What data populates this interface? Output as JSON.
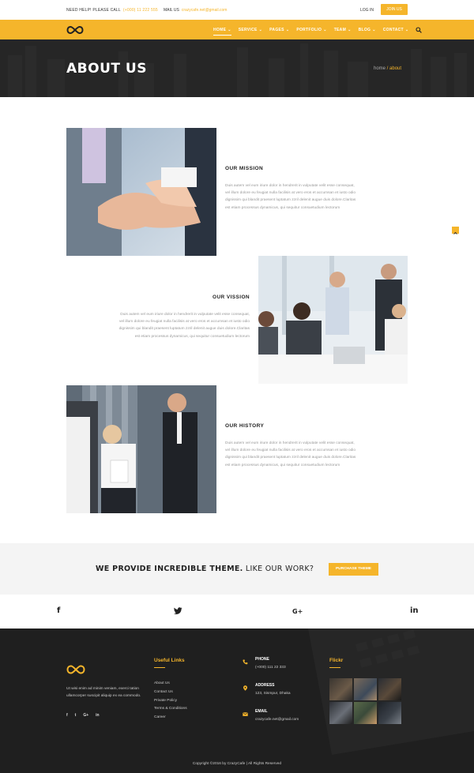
{
  "topbar": {
    "help_label": "NEED HELP! PLEASE CALL",
    "help_phone": "(+000) 11 222 555",
    "mail_label": "MAIL US",
    "mail_value": "crazycafe.net@gmail.com",
    "login": "LOG IN",
    "join": "JOIN US"
  },
  "nav": {
    "items": [
      "HOME",
      "SERVICE",
      "PAGES",
      "PORTFOLIO",
      "TEAM",
      "BLOG",
      "CONTACT"
    ],
    "active_index": 0,
    "icons": {
      "dropdown": "chevron-down-icon",
      "search": "search-icon",
      "logo": "infinity-logo"
    }
  },
  "banner": {
    "title": "ABOUT US",
    "breadcrumb_home": "home",
    "breadcrumb_sep": " / ",
    "breadcrumb_current": "about"
  },
  "blocks": [
    {
      "title": "OUR MISSION",
      "text": "Duis autem vel eum iriure dolor in hendrerit in vulputate velit esse consequat, vel illum dolore eu feugiat nulla facilisis at vero eros et accumsan et iusto odio dignissim qui blandit praesent luptatum zzril delenit augue duis dolore.Claritas est etiam processus dynamicus, qui sequitur consuetudium lectorum"
    },
    {
      "title": "OUR VISSION",
      "text": "Duis autem vel eum iriure dolor in hendrerit in vulputate velit esse consequat, vel illum dolore eu feugiat nulla facilisis at vero eros et accumsan et iusto odio dignissim qui blandit praesent luptatum zzril delenit augue duis dolore.Claritas est etiam processus dynamicus, qui sequitur consuetudium lectorum"
    },
    {
      "title": "OUR HISTORY",
      "text": "Duis autem vel eum iriure dolor in hendrerit in vulputate velit esse consequat, vel illum dolore eu feugiat nulla facilisis at vero eros et accumsan et iusto odio dignissim qui blandit praesent luptatum zzril delenit augue duis dolore.Claritas est etiam processus dynamicus, qui sequitur consuetudium lectorum"
    }
  ],
  "cta": {
    "bold": "WE PROVIDE INCREDIBLE THEME.",
    "light": " LIKE OUR WORK?",
    "button": "PURCHASE THEME"
  },
  "socials": {
    "facebook": "f",
    "twitter": "🐦",
    "google": "G+",
    "linkedin": "in"
  },
  "footer": {
    "about": "Ut wisi enim ad minim veniam, exerci tation ullamcorper suscipit aliquip ex ea commodo.",
    "social": [
      "f",
      "t",
      "G+",
      "in"
    ],
    "useful_links_title": "Useful Links",
    "links": [
      "About Us",
      "Contact Us",
      "Private Policy",
      "Terms & Conditions",
      "Career"
    ],
    "phone_label": "PHONE",
    "phone_value": "(+000) 111 22 333",
    "address_label": "ADDRESS",
    "address_value": "123, Sismpur, Dhaka",
    "email_label": "EMAIL",
    "email_value": "crazycafe.net@gmail.com",
    "flickr_title": "Flickr",
    "copyright": "Copyright ©2016 by CrazyCafe   |   All Rights Reserved"
  },
  "colors": {
    "accent": "#f5b52b",
    "footer_bg": "#1f1f1f",
    "banner_bg": "#2b2b2b"
  }
}
